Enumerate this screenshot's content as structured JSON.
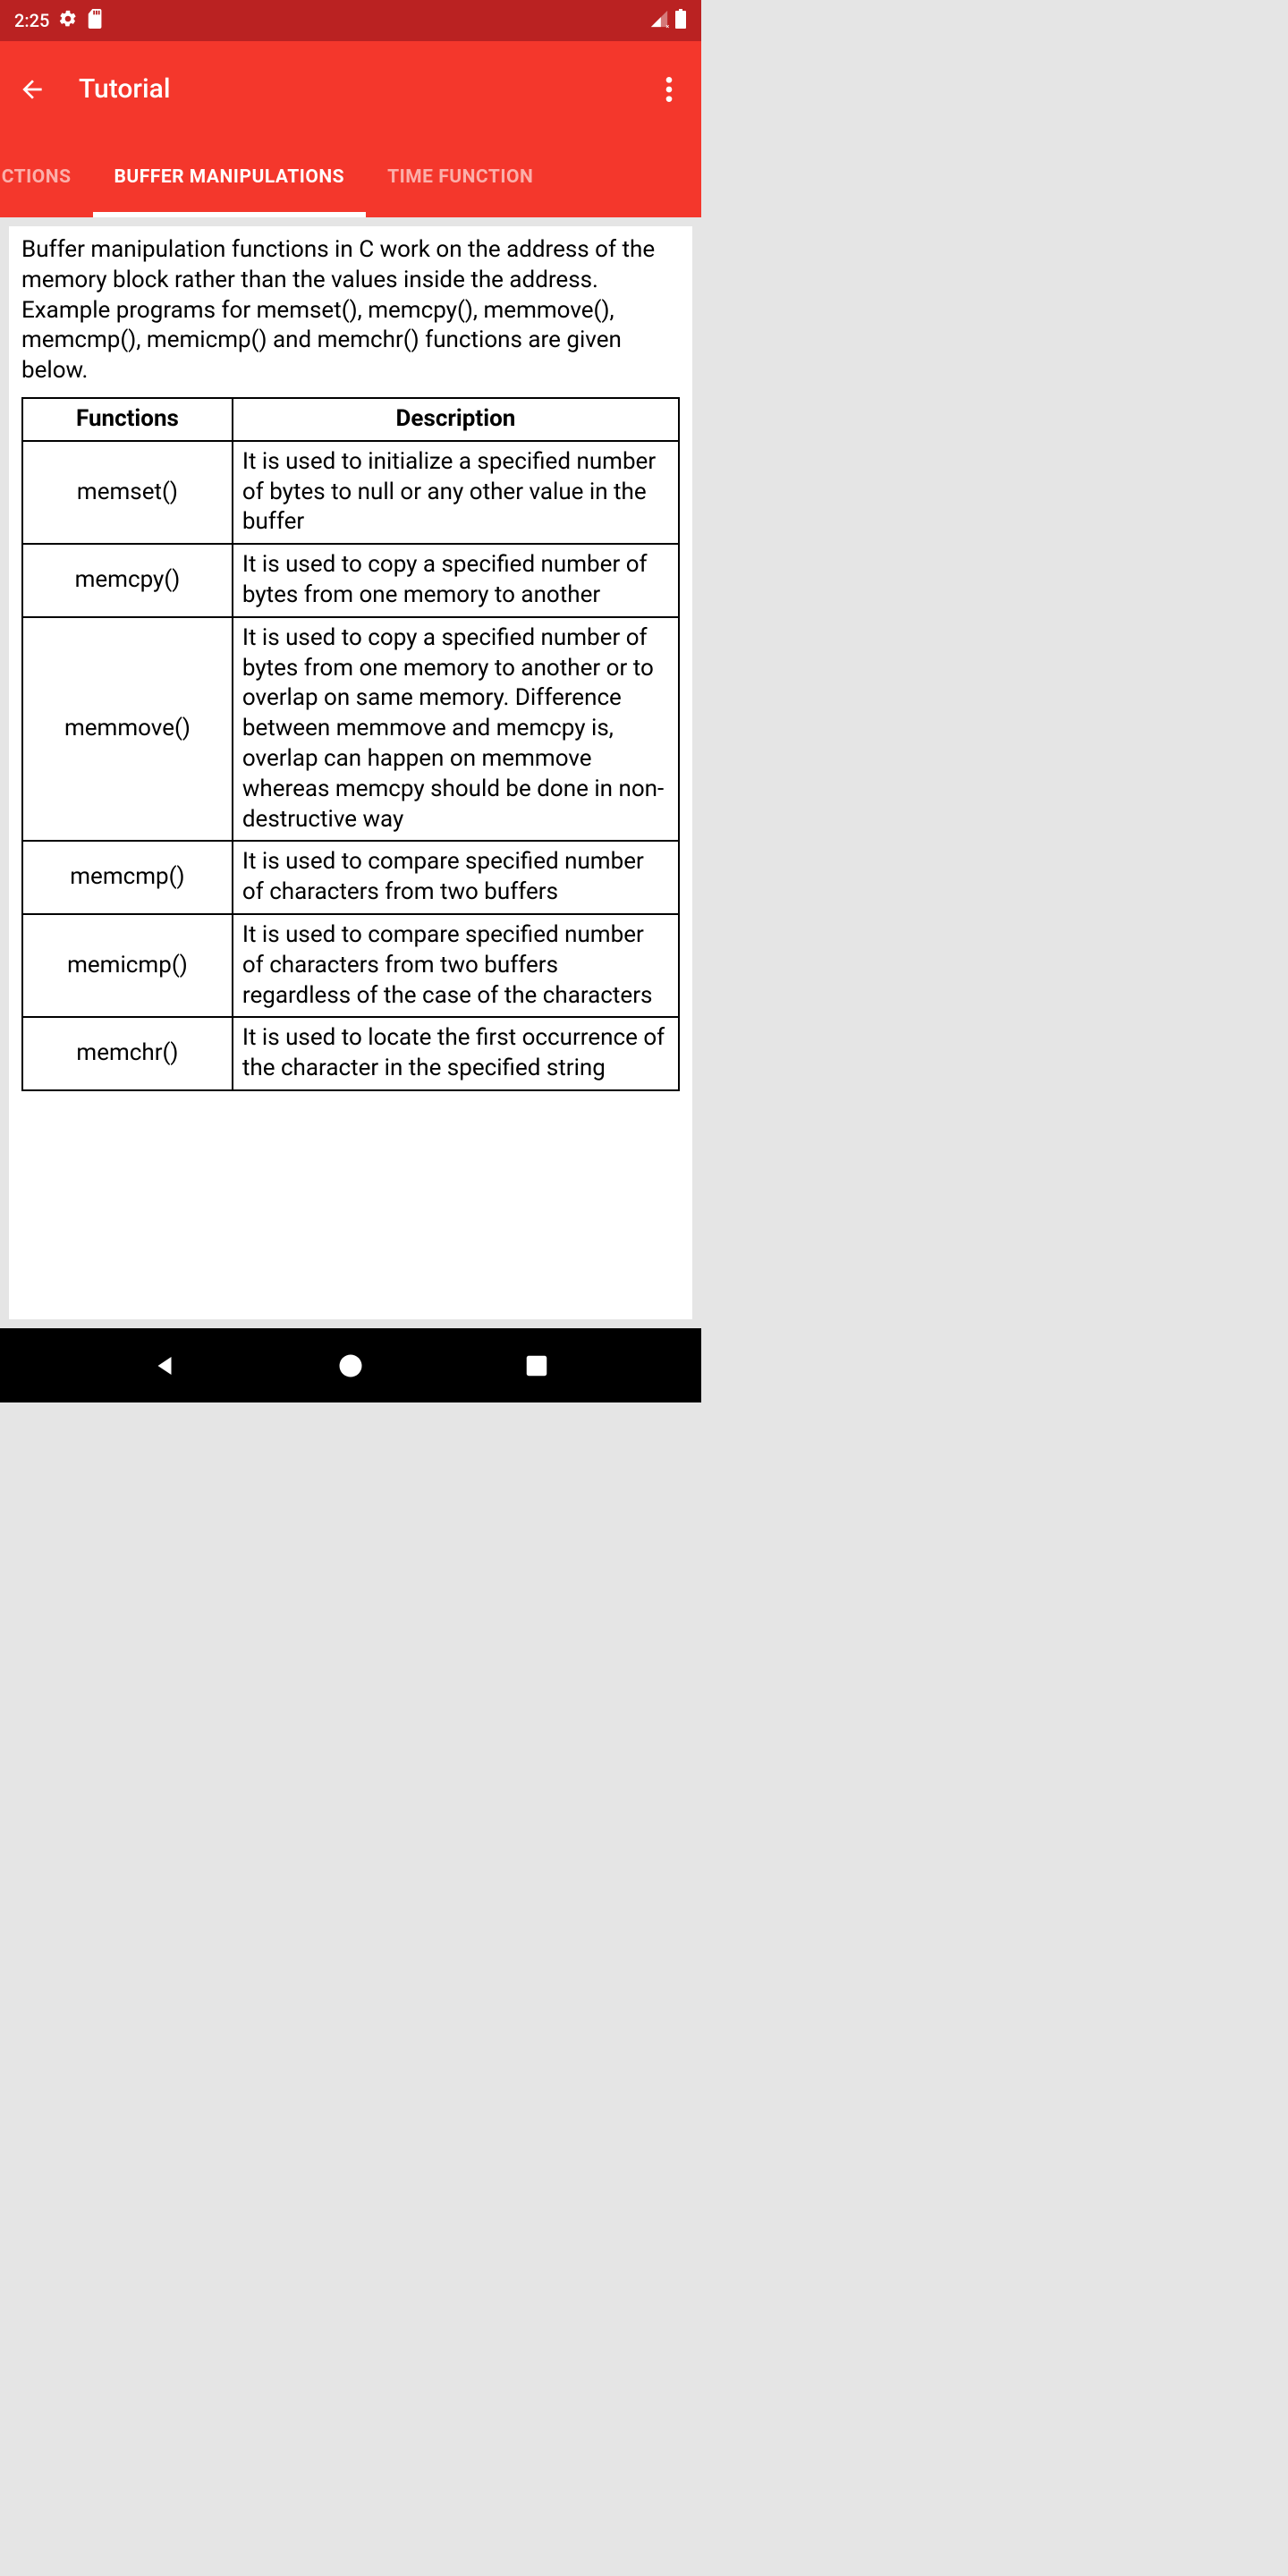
{
  "status": {
    "time": "2:25"
  },
  "app": {
    "title": "Tutorial"
  },
  "tabs": {
    "left": "ON FUNCTIONS",
    "active": "BUFFER MANIPULATIONS",
    "right": "TIME FUNCTION"
  },
  "content": {
    "intro": "Buffer manipulation functions in C work on the address of the memory block rather than the values inside the address. Example programs for memset(), memcpy(), memmove(), memcmp(), memicmp() and memchr() functions are given below.",
    "headers": {
      "col1": "Functions",
      "col2": "Description"
    },
    "rows": [
      {
        "fn": "memset()",
        "desc": "It is used to initialize a specified number of bytes to null or any other value in the buffer"
      },
      {
        "fn": "memcpy()",
        "desc": "It is used to copy a specified number of bytes from one memory to another"
      },
      {
        "fn": "memmove()",
        "desc": "It is used to copy a specified number of bytes from one memory to another or to overlap on same memory. Difference between memmove and memcpy is, overlap can happen on memmove whereas memcpy should be done in non-destructive way"
      },
      {
        "fn": "memcmp()",
        "desc": "It is used to compare specified number of characters from two buffers"
      },
      {
        "fn": "memicmp()",
        "desc": "It is used to compare specified number of characters from two buffers regardless of the case of the characters"
      },
      {
        "fn": "memchr()",
        "desc": "It is used to locate the first occurrence of the character in the specified string"
      }
    ]
  }
}
